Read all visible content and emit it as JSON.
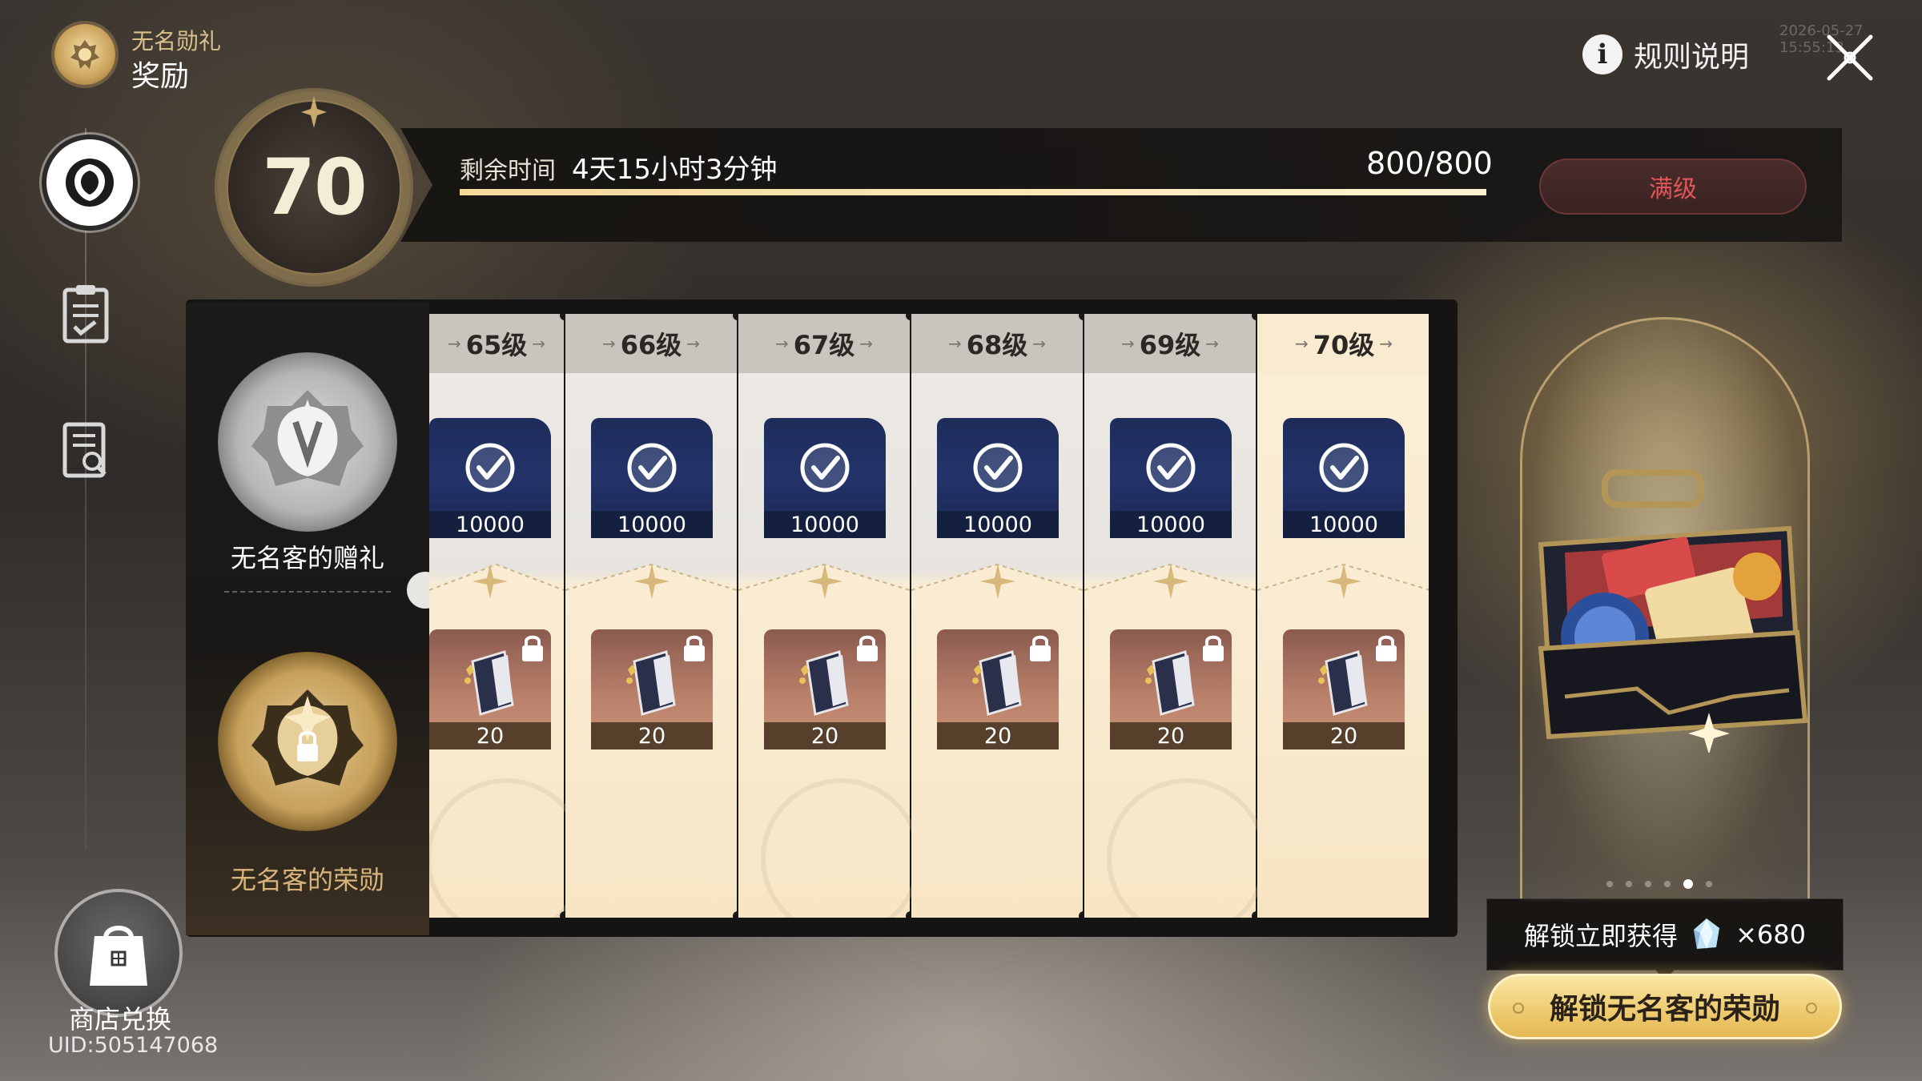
{
  "header": {
    "subtitle": "无名勋礼",
    "title": "奖励",
    "timestamp": "2026-05-27 15:55:13"
  },
  "top_right": {
    "rules_label": "规则说明",
    "info_glyph": "i"
  },
  "left_rail": {
    "items": [
      {
        "name": "honor-emblem-icon",
        "active": true
      },
      {
        "name": "clipboard-tasks-icon",
        "active": false
      },
      {
        "name": "document-search-icon",
        "active": false
      }
    ],
    "shop_label": "商店兑换",
    "uid": "UID:505147068"
  },
  "progress": {
    "level": "70",
    "remaining_label": "剩余时间",
    "remaining_value": "4天15小时3分钟",
    "count": "800/800",
    "fraction": 1.0,
    "max_label": "满级"
  },
  "tracks": {
    "free_label": "无名客的赠礼",
    "paid_label": "无名客的荣勋"
  },
  "levels": [
    {
      "label": "65级",
      "free_qty": "10000",
      "paid_qty": "20",
      "claimed": true,
      "locked": true
    },
    {
      "label": "66级",
      "free_qty": "10000",
      "paid_qty": "20",
      "claimed": true,
      "locked": true
    },
    {
      "label": "67级",
      "free_qty": "10000",
      "paid_qty": "20",
      "claimed": true,
      "locked": true
    },
    {
      "label": "68级",
      "free_qty": "10000",
      "paid_qty": "20",
      "claimed": true,
      "locked": true
    },
    {
      "label": "69级",
      "free_qty": "10000",
      "paid_qty": "20",
      "claimed": true,
      "locked": true
    },
    {
      "label": "70级",
      "free_qty": "10000",
      "paid_qty": "20",
      "claimed": true,
      "locked": true
    }
  ],
  "showcase": {
    "dots": 6,
    "active_dot": 4,
    "unlock_text": "解锁立即获得",
    "unlock_qty": "×680",
    "unlock_button": "解锁无名客的荣勋"
  },
  "colors": {
    "accent_gold": "#e3b853",
    "max_red": "#e05757",
    "progress_fill": "#f2d99a"
  }
}
